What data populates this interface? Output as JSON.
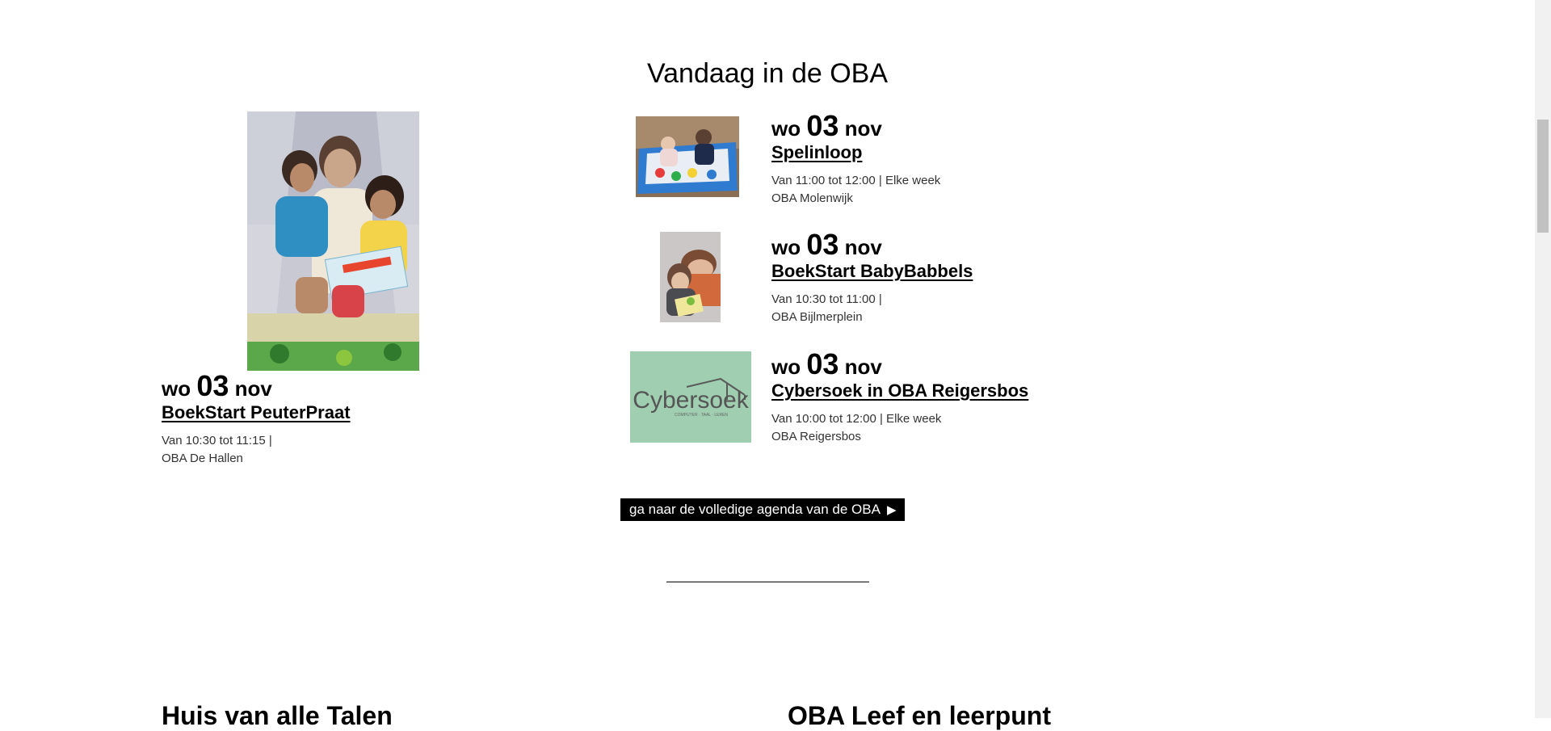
{
  "section": {
    "title": "Vandaag in de OBA"
  },
  "featured_event": {
    "date": {
      "weekday": "wo",
      "day": "03",
      "month": "nov"
    },
    "title": "BoekStart PeuterPraat",
    "time": "Van 10:30 tot 11:15 |",
    "location": "OBA De Hallen"
  },
  "events": [
    {
      "date": {
        "weekday": "wo",
        "day": "03",
        "month": "nov"
      },
      "title": "Spelinloop",
      "time": "Van 11:00 tot 12:00 | Elke week",
      "location": "OBA Molenwijk"
    },
    {
      "date": {
        "weekday": "wo",
        "day": "03",
        "month": "nov"
      },
      "title": "BoekStart BabyBabbels",
      "time": "Van 10:30 tot 11:00 |",
      "location": "OBA Bijlmerplein"
    },
    {
      "date": {
        "weekday": "wo",
        "day": "03",
        "month": "nov"
      },
      "title": "Cybersoek in OBA Reigersbos",
      "time": "Van 10:00 tot 12:00 | Elke week",
      "location": "OBA Reigersbos",
      "logo_text": "Cybersoek",
      "logo_tagline": "COMPUTER · TAAL · LEREN"
    }
  ],
  "agenda_button": {
    "label": "ga naar de volledige agenda van de OBA",
    "icon": "play-arrow-icon"
  },
  "bottom_sections": [
    "Huis van alle Talen",
    "OBA Leef en leerpunt"
  ],
  "colors": {
    "button_bg": "#000000",
    "cybersoek_bg": "#9fceb0"
  }
}
